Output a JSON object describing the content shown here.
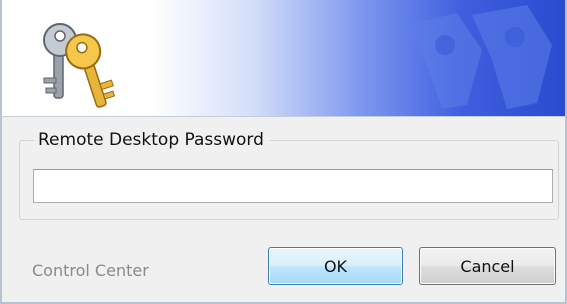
{
  "banner": {
    "icon": "keys-icon",
    "watermark": "keys-watermark-icon"
  },
  "password_group": {
    "label": "Remote Desktop Password",
    "input_value": "",
    "input_placeholder": ""
  },
  "footer": {
    "brand": "Control Center",
    "ok_label": "OK",
    "cancel_label": "Cancel"
  },
  "colors": {
    "dialog_bg": "#f0f0f0",
    "banner_accent": "#2a4acf",
    "ok_border": "#3c7fb1",
    "brand_text": "#8a8a8a"
  }
}
